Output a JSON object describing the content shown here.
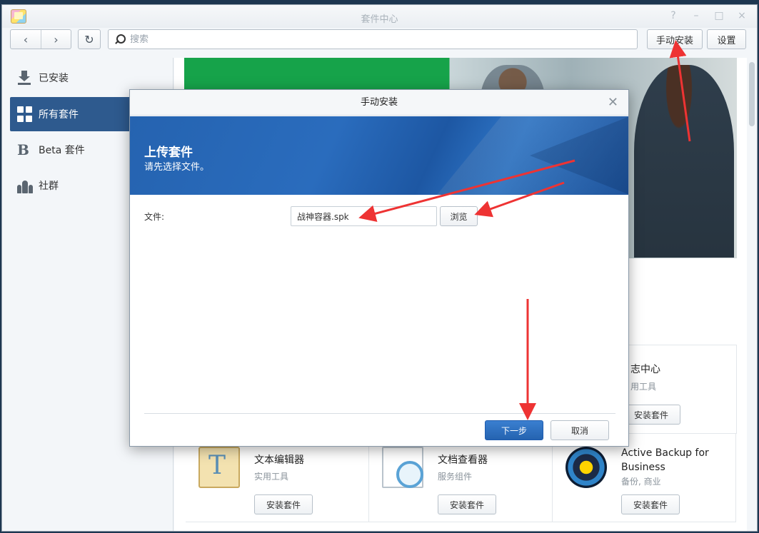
{
  "window": {
    "title": "套件中心",
    "controls": [
      "?",
      "–",
      "□",
      "×"
    ]
  },
  "toolbar": {
    "back_icon": "chevron-left-icon",
    "forward_icon": "chevron-right-icon",
    "refresh_icon": "refresh-icon",
    "search_placeholder": "搜索",
    "manual_install_label": "手动安装",
    "settings_label": "设置"
  },
  "sidebar": {
    "items": [
      {
        "label": "已安装",
        "icon": "download-icon",
        "active": false
      },
      {
        "label": "所有套件",
        "icon": "grid-icon",
        "active": true
      },
      {
        "label": "Beta 套件",
        "icon": "beta-icon",
        "active": false
      },
      {
        "label": "社群",
        "icon": "community-icon",
        "active": false
      }
    ]
  },
  "packages": [
    {
      "name": "日志中心",
      "name_visible": "志中心",
      "category_visible": "用工具",
      "install_label": "安装套件"
    },
    {
      "name": "文本编辑器",
      "category": "实用工具",
      "install_label": "安装套件"
    },
    {
      "name": "文档查看器",
      "category": "服务组件",
      "install_label": "安装套件"
    },
    {
      "name_line1": "Active Backup for",
      "name_line2": "Business",
      "category": "备份, 商业",
      "install_label": "安装套件"
    }
  ],
  "dialog": {
    "title": "手动安装",
    "banner_title": "上传套件",
    "banner_subtitle": "请先选择文件。",
    "file_label": "文件:",
    "file_value": "战神容器.spk",
    "browse_label": "浏览",
    "next_label": "下一步",
    "cancel_label": "取消"
  },
  "colors": {
    "accent": "#2e5a8e",
    "primary_button": "#2563b0",
    "annotation_arrow": "#ee3333",
    "banner_green": "#16a34a"
  }
}
